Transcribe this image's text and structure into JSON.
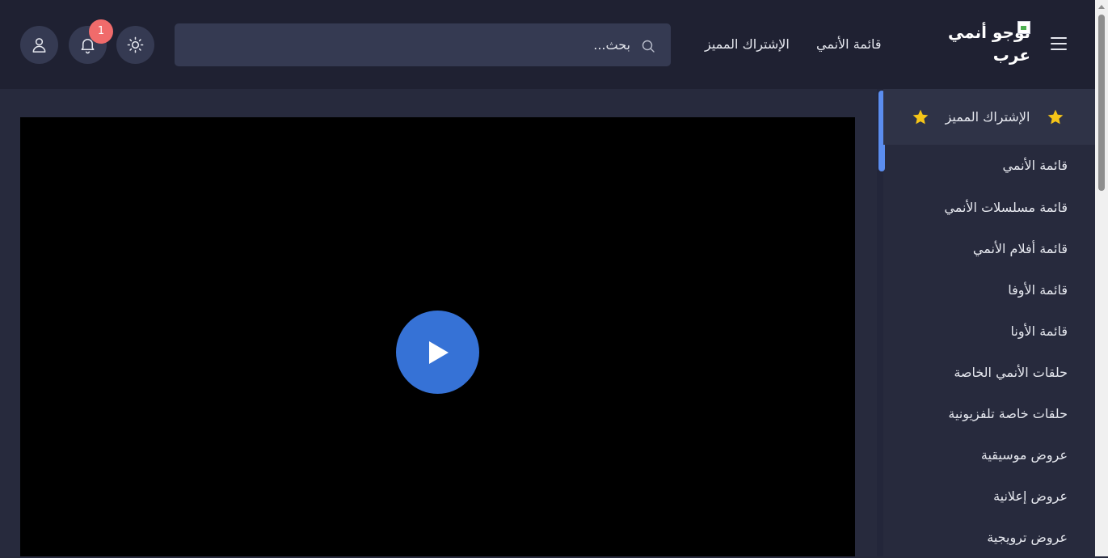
{
  "header": {
    "logo_text": "لوجو أنمي عرب",
    "nav": {
      "anime_list": "قائمة الأنمي",
      "premium": "الإشتراك المميز"
    },
    "search": {
      "placeholder": "بحث..."
    },
    "notifications": {
      "badge_count": "1"
    },
    "icons": {
      "menu": "hamburger-icon",
      "search": "search-icon",
      "theme": "sun-icon",
      "notifications": "bell-icon",
      "user": "user-icon"
    }
  },
  "video": {
    "play_icon": "play-icon",
    "accent_color": "#3672d6"
  },
  "sidebar": {
    "premium_label": "الإشتراك المميز",
    "premium_icon": "star-icon",
    "items": [
      {
        "label": "قائمة الأنمي"
      },
      {
        "label": "قائمة مسلسلات الأنمي"
      },
      {
        "label": "قائمة أفلام الأنمي"
      },
      {
        "label": "قائمة الأوفا"
      },
      {
        "label": "قائمة الأونا"
      },
      {
        "label": "حلقات الأنمي الخاصة"
      },
      {
        "label": "حلقات خاصة تلفزيونية"
      },
      {
        "label": "عروض موسيقية"
      },
      {
        "label": "عروض إعلانية"
      },
      {
        "label": "عروض ترويجية"
      }
    ]
  },
  "colors": {
    "header_bg": "#1f2132",
    "page_bg": "#272a3d",
    "control_bg": "#353a52",
    "badge": "#f06b6b",
    "star": "#f5c518",
    "scroll_accent": "#5b8def"
  }
}
